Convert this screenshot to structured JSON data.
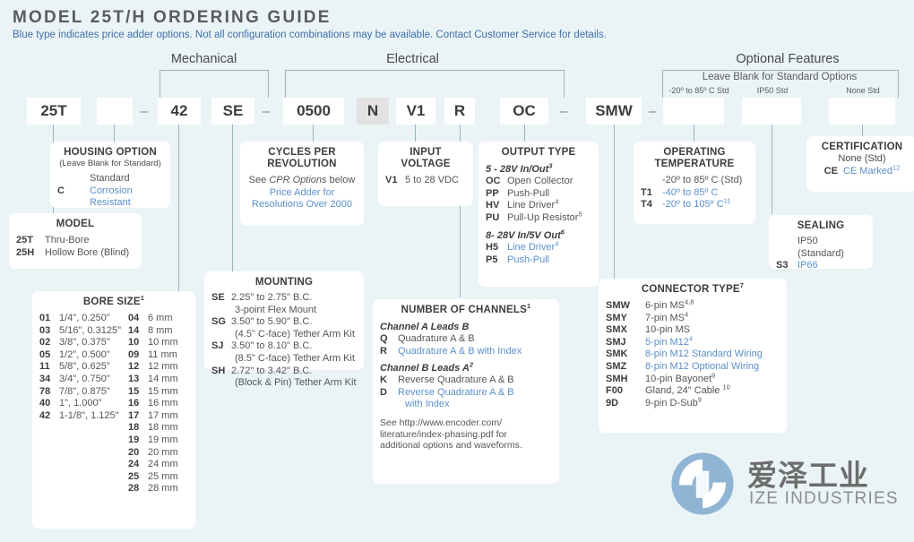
{
  "header": {
    "title": "MODEL 25T/H ORDERING GUIDE",
    "subtitle": "Blue type indicates price adder options. Not all configuration combinations may be available. Contact Customer Service for details."
  },
  "groups": {
    "mechanical": "Mechanical",
    "electrical": "Electrical",
    "optional_features": "Optional Features",
    "leave_blank": "Leave Blank for Standard Options",
    "temp_std": "-20º to 85º C Std",
    "ip_std": "IP50 Std",
    "none_std": "None Std"
  },
  "part_number": {
    "boxes": [
      {
        "value": "25T",
        "shaded": false
      },
      {
        "value": "",
        "shaded": false
      },
      {
        "value": "42",
        "shaded": false
      },
      {
        "value": "SE",
        "shaded": false
      },
      {
        "value": "0500",
        "shaded": false
      },
      {
        "value": "N",
        "shaded": true
      },
      {
        "value": "V1",
        "shaded": false
      },
      {
        "value": "R",
        "shaded": false
      },
      {
        "value": "OC",
        "shaded": false
      },
      {
        "value": "SMW",
        "shaded": false
      },
      {
        "value": "",
        "shaded": false
      },
      {
        "value": "",
        "shaded": false
      },
      {
        "value": "",
        "shaded": false
      }
    ],
    "dash": "–"
  },
  "panels": {
    "housing_option": {
      "title": "HOUSING OPTION",
      "subtitle": "(Leave Blank for Standard)",
      "rows": [
        {
          "code": "",
          "text": "Standard",
          "blue": false
        },
        {
          "code": "C",
          "text": "Corrosion Resistant",
          "blue": true
        }
      ]
    },
    "model": {
      "title": "MODEL",
      "rows": [
        {
          "code": "25T",
          "text": "Thru-Bore",
          "blue": false
        },
        {
          "code": "25H",
          "text": "Hollow Bore (Blind)",
          "blue": false
        }
      ]
    },
    "bore_size": {
      "title": "BORE SIZE",
      "title_sup": "1",
      "col1": [
        {
          "code": "01",
          "text": "1/4\", 0.250\""
        },
        {
          "code": "03",
          "text": "5/16\", 0.3125\""
        },
        {
          "code": "02",
          "text": "3/8\", 0.375\""
        },
        {
          "code": "05",
          "text": "1/2\", 0.500\""
        },
        {
          "code": "11",
          "text": "5/8\", 0.625\""
        },
        {
          "code": "34",
          "text": "3/4\", 0.750\""
        },
        {
          "code": "78",
          "text": "7/8\", 0.875\""
        },
        {
          "code": "40",
          "text": "1\", 1.000\""
        },
        {
          "code": "42",
          "text": "1-1/8\", 1.125\""
        }
      ],
      "col2": [
        {
          "code": "04",
          "text": "6 mm"
        },
        {
          "code": "14",
          "text": "8 mm"
        },
        {
          "code": "10",
          "text": "10 mm"
        },
        {
          "code": "09",
          "text": "11 mm"
        },
        {
          "code": "12",
          "text": "12 mm"
        },
        {
          "code": "13",
          "text": "14 mm"
        },
        {
          "code": "15",
          "text": "15 mm"
        },
        {
          "code": "16",
          "text": "16 mm"
        },
        {
          "code": "17",
          "text": "17 mm"
        },
        {
          "code": "18",
          "text": "18 mm"
        },
        {
          "code": "19",
          "text": "19 mm"
        },
        {
          "code": "20",
          "text": "20 mm"
        },
        {
          "code": "24",
          "text": "24 mm"
        },
        {
          "code": "25",
          "text": "25 mm"
        },
        {
          "code": "28",
          "text": "28 mm"
        }
      ]
    },
    "mounting": {
      "title": "MOUNTING",
      "rows": [
        {
          "code": "SE",
          "line1": "2.25\" to 2.75\" B.C.",
          "line2": "3-point Flex Mount"
        },
        {
          "code": "SG",
          "line1": "3.50\" to 5.90\" B.C.",
          "line2": "(4.5\" C-face) Tether Arm Kit"
        },
        {
          "code": "SJ",
          "line1": "3.50\" to 8.10\" B.C.",
          "line2": "(8.5\" C-face) Tether Arm Kit"
        },
        {
          "code": "SH",
          "line1": "2.72\" to 3.42\" B.C.",
          "line2": "(Block & Pin) Tether Arm Kit"
        }
      ]
    },
    "cycles_per_revolution": {
      "title_line1": "CYCLES PER",
      "title_line2": "REVOLUTION",
      "see_line": "See CPR Options below",
      "see_plain_1": "See ",
      "see_italic": "CPR Options",
      "see_plain_2": " below",
      "blue_line1": "Price Adder for",
      "blue_line2": "Resolutions Over 2000"
    },
    "input_voltage": {
      "title_line1": "INPUT",
      "title_line2": "VOLTAGE",
      "rows": [
        {
          "code": "V1",
          "text": "5 to 28 VDC"
        }
      ]
    },
    "output_type": {
      "title": "OUTPUT TYPE",
      "group1_head": "5 - 28V In/Out",
      "group1_sup": "3",
      "group1": [
        {
          "code": "OC",
          "text": "Open Collector",
          "sup": "",
          "blue": false
        },
        {
          "code": "PP",
          "text": "Push-Pull",
          "sup": "",
          "blue": false
        },
        {
          "code": "HV",
          "text": "Line Driver",
          "sup": "4",
          "blue": false
        },
        {
          "code": "PU",
          "text": "Pull-Up Resistor",
          "sup": "5",
          "blue": false
        }
      ],
      "group2_head": "8- 28V In/5V Out",
      "group2_sup": "6",
      "group2": [
        {
          "code": "H5",
          "text": "Line Driver",
          "sup": "4",
          "blue": true
        },
        {
          "code": "P5",
          "text": "Push-Pull",
          "sup": "",
          "blue": true
        }
      ]
    },
    "number_of_channels": {
      "title": "NUMBER OF CHANNELS",
      "title_sup": "1",
      "group1_head": "Channel A Leads B",
      "group1_sup": "",
      "group1": [
        {
          "code": "Q",
          "text": "Quadrature A & B",
          "blue": false
        },
        {
          "code": "R",
          "text": "Quadrature A & B with Index",
          "blue": true
        }
      ],
      "group2_head": "Channel B Leads A",
      "group2_sup": "2",
      "group2": [
        {
          "code": "K",
          "text": "Reverse Quadrature A & B",
          "blue": false
        },
        {
          "code": "D",
          "text": "Reverse Quadrature A & B",
          "text2": "with Index",
          "blue": true
        }
      ],
      "note_line1": "See http://www.encoder.com/",
      "note_line2": "literature/index-phasing.pdf for",
      "note_line3": "additional options and waveforms."
    },
    "connector_type": {
      "title": "CONNECTOR TYPE",
      "title_sup": "7",
      "rows": [
        {
          "code": "SMW",
          "text": "6-pin MS",
          "sup": "4,8",
          "blue": false
        },
        {
          "code": "SMY",
          "text": "7-pin MS",
          "sup": "4",
          "blue": false
        },
        {
          "code": "SMX",
          "text": "10-pin MS",
          "sup": "",
          "blue": false
        },
        {
          "code": "SMJ",
          "text": "5-pin M12",
          "sup": "4",
          "blue": true
        },
        {
          "code": "SMK",
          "text": "8-pin M12 Standard Wiring",
          "sup": "",
          "blue": true
        },
        {
          "code": "SMZ",
          "text": "8-pin M12 Optional Wiring",
          "sup": "",
          "blue": true
        },
        {
          "code": "SMH",
          "text": "10-pin Bayonet",
          "sup": "9",
          "blue": false
        },
        {
          "code": "F00",
          "text": "Gland, 24\" Cable ",
          "sup": "10",
          "blue": false
        },
        {
          "code": "9D",
          "text": "9-pin D-Sub",
          "sup": "9",
          "blue": false
        }
      ]
    },
    "operating_temperature": {
      "title_line1": "OPERATING",
      "title_line2": "TEMPERATURE",
      "rows": [
        {
          "code": "",
          "text": "-20º to 85º C (Std)",
          "sup": "",
          "blue": false
        },
        {
          "code": "T1",
          "text": "-40º to 85º C",
          "sup": "",
          "blue": true
        },
        {
          "code": "T4",
          "text": "-20º to 105º C",
          "sup": "11",
          "blue": true
        }
      ]
    },
    "sealing": {
      "title": "SEALING",
      "rows": [
        {
          "code": "",
          "text": "IP50 (Standard)",
          "blue": false
        },
        {
          "code": "S3",
          "text": "IP66",
          "blue": true
        }
      ]
    },
    "certification": {
      "title": "CERTIFICATION",
      "subtitle": "None (Std)",
      "rows": [
        {
          "code": "CE",
          "text": "CE Marked",
          "sup": "12",
          "blue": true
        }
      ]
    }
  },
  "logo": {
    "cn": "爱泽工业",
    "en": "IZE INDUSTRIES",
    "color": "#8fb4d4"
  },
  "colors": {
    "background": "#eaf4f6",
    "blue_text": "#5b8fc9",
    "line": "#9bb3ba",
    "panel": "#ffffff"
  }
}
